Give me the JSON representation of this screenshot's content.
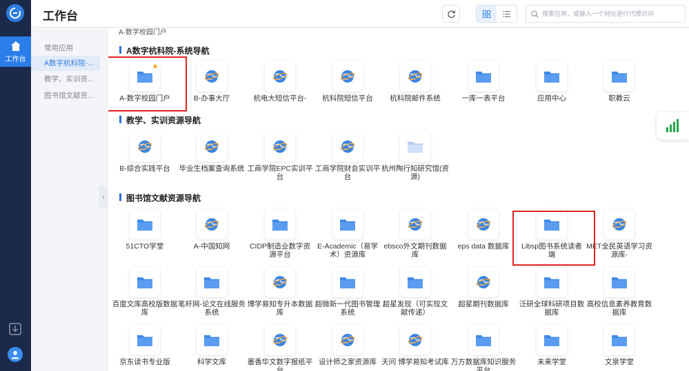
{
  "header": {
    "title": "工作台",
    "search_placeholder": "搜索应用，或输入一个网址进行代理访问"
  },
  "rail": {
    "home_label": "工作台"
  },
  "sidebar": {
    "items": [
      {
        "label": "常用应用",
        "active": false
      },
      {
        "label": "A数字杭科院-...",
        "active": true
      },
      {
        "label": "教学、实训资...",
        "active": false
      },
      {
        "label": "图书馆文献资...",
        "active": false
      }
    ]
  },
  "main": {
    "breadcrumb": "A-数字校园门户",
    "sections": [
      {
        "title": "A数字杭科院-系统导航",
        "apps": [
          {
            "label": "A-数字校园门户",
            "icon": "folder-icon",
            "starred": true
          },
          {
            "label": "B-办事大厅",
            "icon": "globe-icon"
          },
          {
            "label": "杭电大短信平台-",
            "icon": "globe-icon"
          },
          {
            "label": "杭科院短信平台",
            "icon": "globe-icon"
          },
          {
            "label": "杭科院邮件系统",
            "icon": "globe-icon"
          },
          {
            "label": "一库一表平台",
            "icon": "folder-icon"
          },
          {
            "label": "应用中心",
            "icon": "folder-icon"
          },
          {
            "label": "职教云",
            "icon": "folder-icon"
          }
        ]
      },
      {
        "title": "教学、实训资源导航",
        "apps": [
          {
            "label": "B-综合实践平台",
            "icon": "globe-icon"
          },
          {
            "label": "毕业生档案查询系统",
            "icon": "globe-icon"
          },
          {
            "label": "工商学院EPC实训平台",
            "icon": "globe-icon"
          },
          {
            "label": "工商学院财会实训平台",
            "icon": "globe-icon"
          },
          {
            "label": "杭州陶行知研究馆(资源)",
            "icon": "folder-light-icon"
          }
        ]
      },
      {
        "title": "图书馆文献资源导航",
        "apps": [
          {
            "label": "51CTO学堂",
            "icon": "folder-icon"
          },
          {
            "label": "A-中国知网",
            "icon": "globe-icon"
          },
          {
            "label": "CIDP制造业数字资源平台",
            "icon": "folder-icon"
          },
          {
            "label": "E-Academic（易学术）资源库",
            "icon": "folder-icon"
          },
          {
            "label": "ebsco外文期刊数据库",
            "icon": "globe-icon"
          },
          {
            "label": "eps data 数据库",
            "icon": "globe-icon"
          },
          {
            "label": "Libsp图书系统读者端",
            "icon": "folder-icon"
          },
          {
            "label": "MET全民英语学习资源库-",
            "icon": "globe-icon"
          },
          {
            "label": "百度文库高校版数据库",
            "icon": "folder-icon"
          },
          {
            "label": "笔杆网-论文在线服务系统",
            "icon": "folder-icon"
          },
          {
            "label": "博学易知专升本数据库",
            "icon": "globe-icon"
          },
          {
            "label": "超微新一代图书管理系统",
            "icon": "folder-icon"
          },
          {
            "label": "超星发现（可实现文献传递）",
            "icon": "folder-icon"
          },
          {
            "label": "超星期刊数据库",
            "icon": "globe-icon"
          },
          {
            "label": "泛研全球科研项目数据库",
            "icon": "folder-icon"
          },
          {
            "label": "高校信息素养教育数据库",
            "icon": "folder-icon"
          },
          {
            "label": "京东读书专业版",
            "icon": "folder-icon"
          },
          {
            "label": "科学文库",
            "icon": "folder-icon"
          },
          {
            "label": "墨香华文数字报纸平台",
            "icon": "globe-icon"
          },
          {
            "label": "设计师之家资源库",
            "icon": "globe-icon"
          },
          {
            "label": "天问 博学易知考试库",
            "icon": "globe-icon"
          },
          {
            "label": "万方数据库知识服务平台",
            "icon": "folder-icon"
          },
          {
            "label": "未来学堂",
            "icon": "folder-icon"
          },
          {
            "label": "文泉学堂",
            "icon": "folder-icon"
          }
        ]
      }
    ]
  },
  "colors": {
    "accent": "#2f7de1",
    "rail_bg": "#1b2a4a",
    "highlight": "#e02020"
  }
}
